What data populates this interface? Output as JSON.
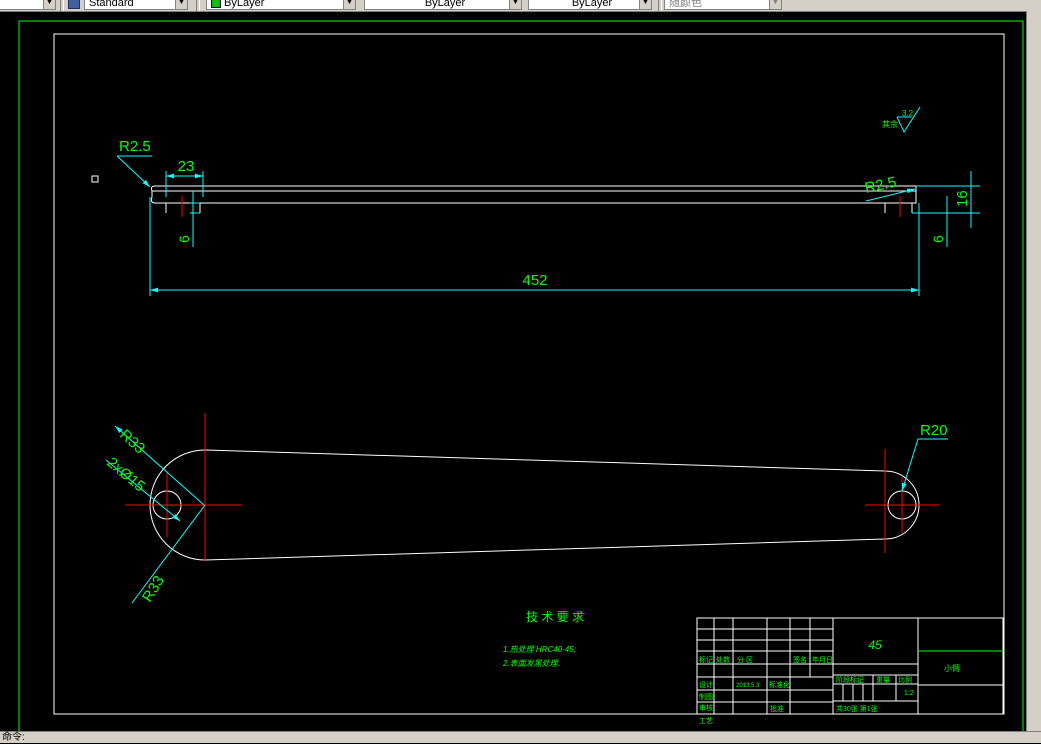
{
  "toolbar": {
    "text_style": "Standard",
    "layer": "ByLayer",
    "linetype": "ByLayer",
    "lineweight": "ByLayer",
    "plot_style": "随颜色"
  },
  "colors": {
    "background": "#000000",
    "geometry": "#ffffff",
    "dimension": "#00ffff",
    "dim_text": "#00ff00",
    "centerline": "#ff0000",
    "border": "#ffffff"
  },
  "drawing": {
    "top_view": {
      "dims": {
        "left_radius": "R2.5",
        "left_width": "23",
        "left_depth": "6",
        "right_radius": "R2.5",
        "right_depth": "6",
        "height": "16",
        "length": "452"
      }
    },
    "front_view": {
      "dims": {
        "big_radius_top": "R33",
        "holes": "2xØ15",
        "big_radius_bottom": "R33",
        "small_radius": "R20"
      }
    },
    "roughness": {
      "label": "其余",
      "value": "3.2"
    },
    "tech_requirements": {
      "title": "技 术 要 求",
      "items": [
        "1.热处理 HRC40-45;",
        "2.表面发黑处理."
      ]
    },
    "title_block": {
      "material": "45",
      "part_name": "小臂",
      "headers": [
        "标记",
        "处数",
        "分 区",
        "",
        "签名",
        "年月日"
      ],
      "row_design": [
        "设计",
        "",
        "2013.5.3",
        "标准化"
      ],
      "rows_left": [
        "制图",
        "审核",
        "工艺"
      ],
      "approve": "批准",
      "stage_labels": [
        "阶段标记",
        "重量",
        "比例"
      ],
      "scale": "1:2",
      "sheet_info": "共30张  第1张"
    }
  },
  "status": {
    "prompt": "命令:"
  }
}
